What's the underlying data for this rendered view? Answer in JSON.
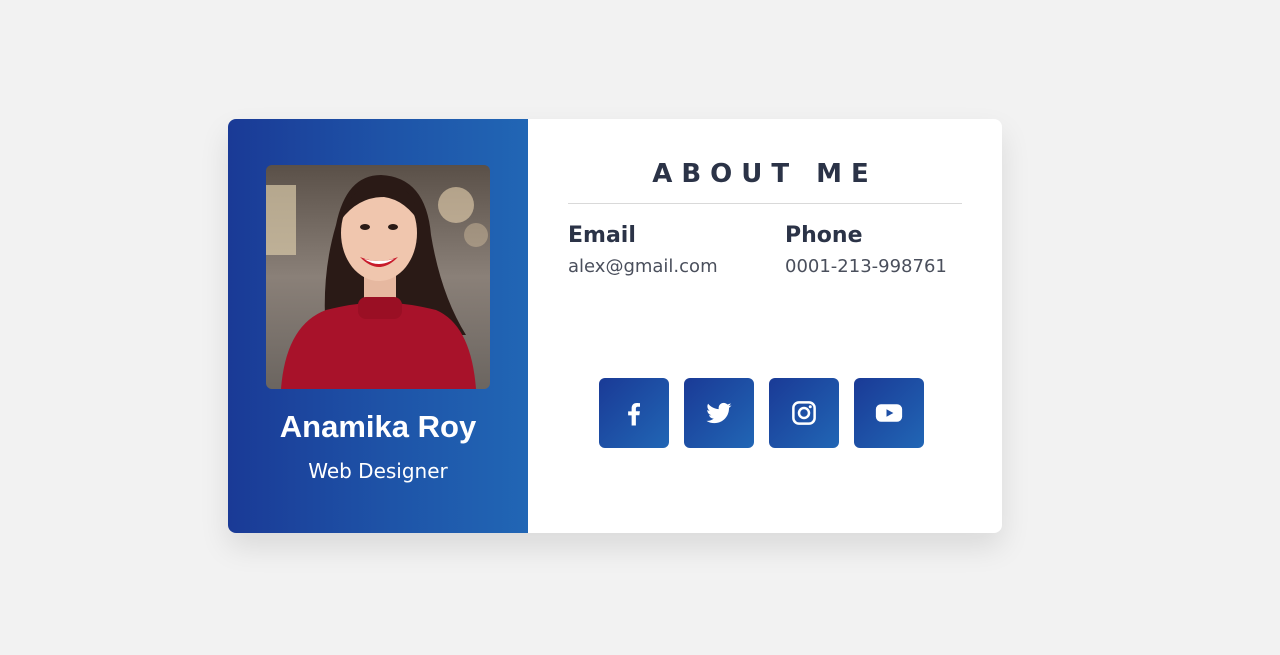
{
  "profile": {
    "name": "Anamika Roy",
    "role": "Web Designer",
    "photo_alt": "profile-photo"
  },
  "about": {
    "title": "ABOUT ME",
    "email_label": "Email",
    "email_value": "alex@gmail.com",
    "phone_label": "Phone",
    "phone_value": "0001-213-998761"
  },
  "socials": [
    {
      "icon": "facebook-icon"
    },
    {
      "icon": "twitter-icon"
    },
    {
      "icon": "instagram-icon"
    },
    {
      "icon": "youtube-icon"
    }
  ],
  "colors": {
    "background": "#f2f2f2",
    "accent_dark": "#1a3a96",
    "accent_light": "#2166b5",
    "text_dark": "#2b3347"
  }
}
